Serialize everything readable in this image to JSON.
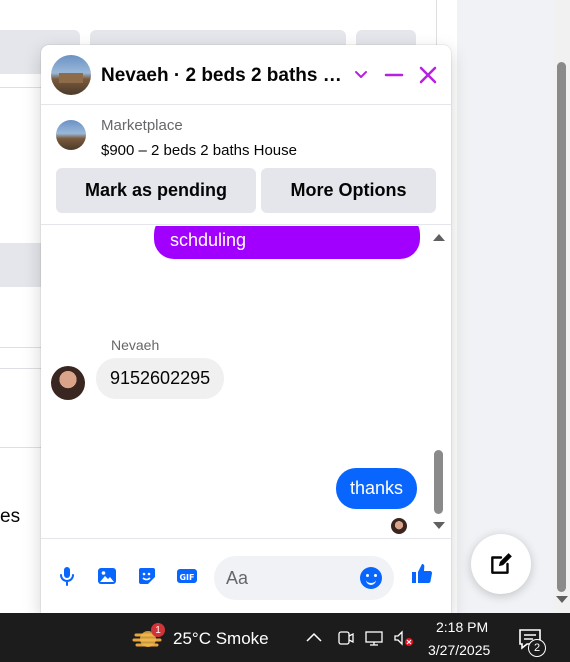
{
  "background": {
    "partial_text": "es"
  },
  "chat": {
    "title": "Nevaeh · 2 beds 2 baths H…",
    "listing": {
      "source": "Marketplace",
      "title": "$900 – 2 beds 2 baths House",
      "buttons": [
        "Mark as pending",
        "More Options"
      ]
    },
    "messages": [
      {
        "direction": "out",
        "text": "schduling",
        "color": "#a100ff"
      },
      {
        "direction": "in",
        "sender": "Nevaeh",
        "text": "9152602295"
      },
      {
        "direction": "out",
        "text": "thanks",
        "color": "#0866ff"
      }
    ],
    "composer": {
      "placeholder": "Aa",
      "icons": [
        "microphone-icon",
        "image-icon",
        "sticker-icon",
        "gif-icon",
        "emoji-icon",
        "thumbs-up-icon"
      ]
    },
    "accent_color": "#b620e0"
  },
  "taskbar": {
    "weather": "25°C  Smoke",
    "weather_badge": "1",
    "time": "2:18 PM",
    "date": "3/27/2025",
    "notification_count": "2"
  }
}
